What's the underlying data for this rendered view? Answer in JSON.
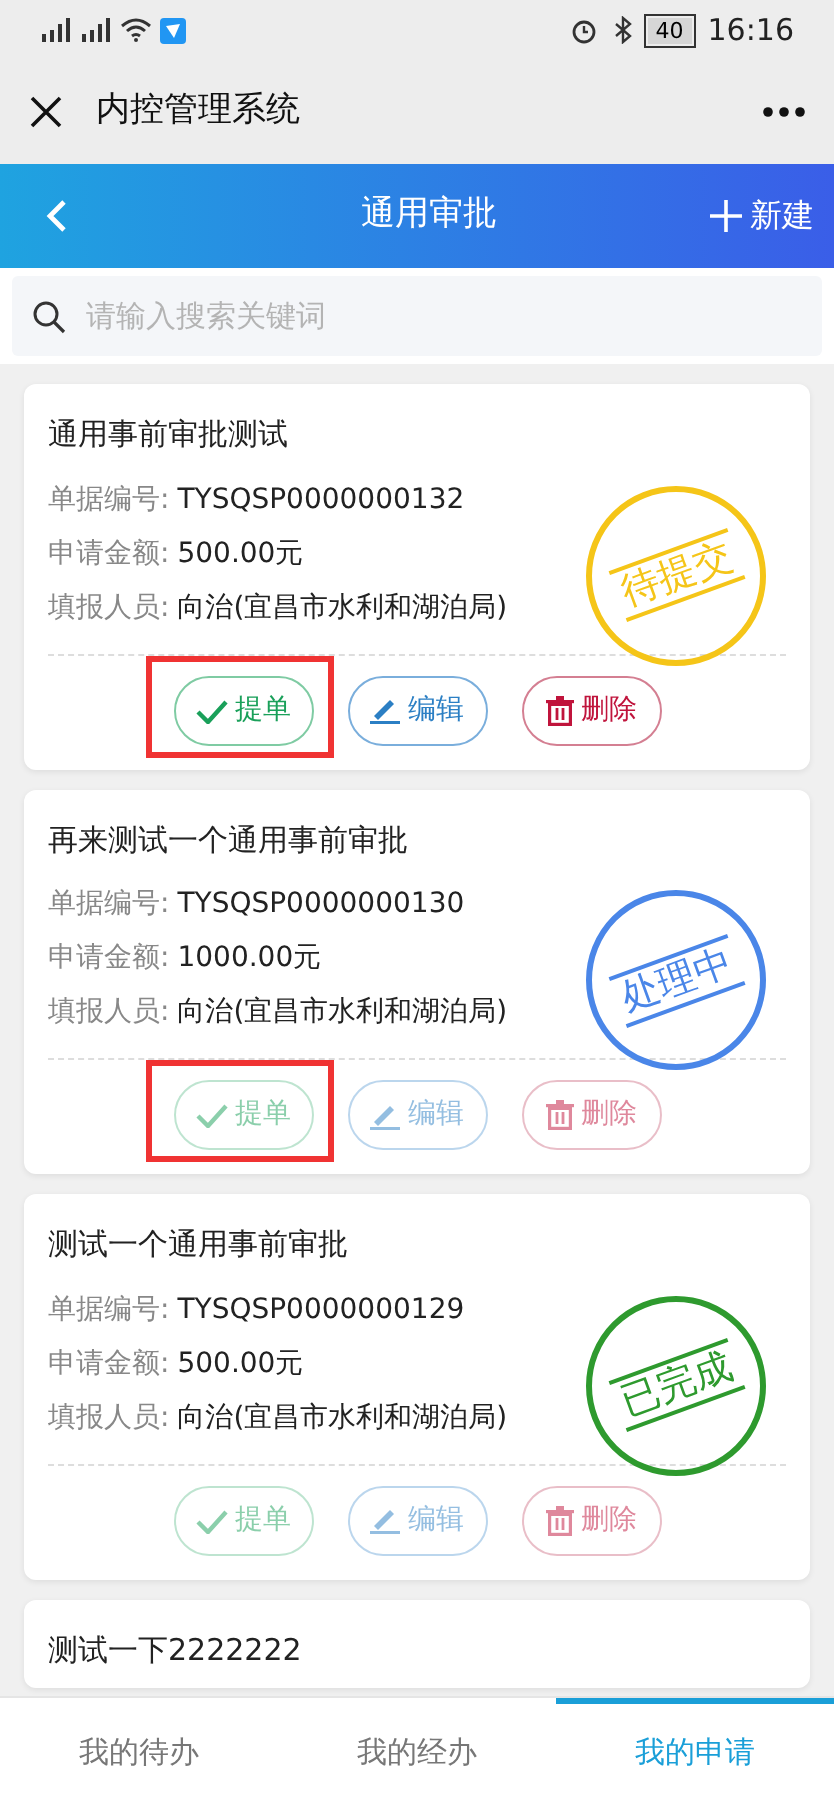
{
  "status_bar": {
    "battery": "40",
    "time": "16:16"
  },
  "app_bar": {
    "title": "内控管理系统"
  },
  "header": {
    "title": "通用审批",
    "new_button": "新建"
  },
  "search": {
    "placeholder": "请输入搜索关键词"
  },
  "records": [
    {
      "title": "通用事前审批测试",
      "fields": [
        {
          "label": "单据编号:",
          "value": "TYSQSP0000000132"
        },
        {
          "label": "申请金额:",
          "value": "500.00元"
        },
        {
          "label": "填报人员:",
          "value": "向治(宜昌市水利和湖泊局)"
        }
      ],
      "stamp": "待提交",
      "color": "#f5c518",
      "actions_disabled": false,
      "highlighted": true,
      "actions": [
        {
          "kind": "submit",
          "label": "提单"
        },
        {
          "kind": "edit",
          "label": "编辑"
        },
        {
          "kind": "delete",
          "label": "删除"
        }
      ]
    },
    {
      "title": "再来测试一个通用事前审批",
      "fields": [
        {
          "label": "单据编号:",
          "value": "TYSQSP0000000130"
        },
        {
          "label": "申请金额:",
          "value": "1000.00元"
        },
        {
          "label": "填报人员:",
          "value": "向治(宜昌市水利和湖泊局)"
        }
      ],
      "stamp": "处理中",
      "color": "#4a86e8",
      "actions_disabled": true,
      "highlighted": true,
      "actions": [
        {
          "kind": "submit",
          "label": "提单"
        },
        {
          "kind": "edit",
          "label": "编辑"
        },
        {
          "kind": "delete",
          "label": "删除"
        }
      ]
    },
    {
      "title": "测试一个通用事前审批",
      "fields": [
        {
          "label": "单据编号:",
          "value": "TYSQSP0000000129"
        },
        {
          "label": "申请金额:",
          "value": "500.00元"
        },
        {
          "label": "填报人员:",
          "value": "向治(宜昌市水利和湖泊局)"
        }
      ],
      "stamp": "已完成",
      "color": "#2e9a2e",
      "actions_disabled": true,
      "highlighted": false,
      "actions": [
        {
          "kind": "submit",
          "label": "提单"
        },
        {
          "kind": "edit",
          "label": "编辑"
        },
        {
          "kind": "delete",
          "label": "删除"
        }
      ]
    },
    {
      "title": "测试一下2222222"
    }
  ],
  "tabs": [
    {
      "label": "我的待办",
      "selected": false
    },
    {
      "label": "我的经办",
      "selected": false
    },
    {
      "label": "我的申请",
      "selected": true
    }
  ]
}
